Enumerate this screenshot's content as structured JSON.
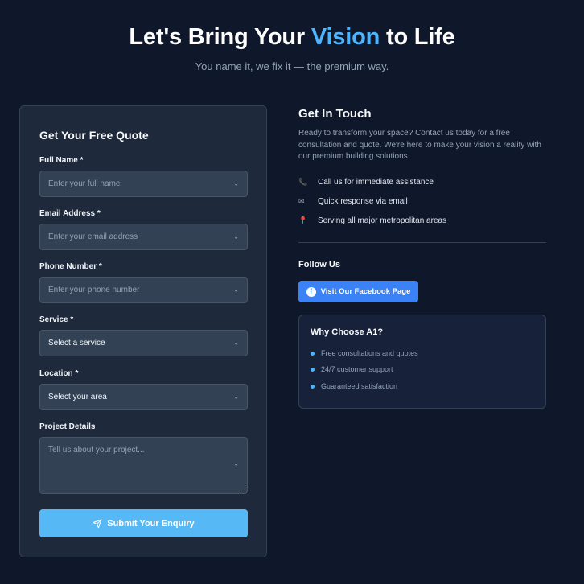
{
  "hero": {
    "title_before": "Let's Bring Your ",
    "title_accent": "Vision",
    "title_after": " to Life",
    "subtitle": "You name it, we fix it — the premium way."
  },
  "form": {
    "title": "Get Your Free Quote",
    "full_name": {
      "label": "Full Name *",
      "placeholder": "Enter your full name"
    },
    "email": {
      "label": "Email Address *",
      "placeholder": "Enter your email address"
    },
    "phone": {
      "label": "Phone Number *",
      "placeholder": "Enter your phone number"
    },
    "service": {
      "label": "Service *",
      "value": "Select a service"
    },
    "location": {
      "label": "Location *",
      "value": "Select your area"
    },
    "details": {
      "label": "Project Details",
      "placeholder": "Tell us about your project..."
    },
    "submit_label": "Submit Your Enquiry"
  },
  "contact": {
    "title": "Get In Touch",
    "description": "Ready to transform your space? Contact us today for a free consultation and quote. We're here to make your vision a reality with our premium building solutions.",
    "items": [
      {
        "icon": "phone-icon",
        "text": "Call us for immediate assistance"
      },
      {
        "icon": "email-icon",
        "text": "Quick response via email"
      },
      {
        "icon": "location-icon",
        "text": "Serving all major metropolitan areas"
      }
    ]
  },
  "follow": {
    "title": "Follow Us",
    "facebook_label": "Visit Our Facebook Page"
  },
  "why": {
    "title": "Why Choose A1?",
    "items": [
      "Free consultations and quotes",
      "24/7 customer support",
      "Guaranteed satisfaction"
    ]
  },
  "colors": {
    "background": "#0f172a",
    "accent": "#4db5ff",
    "submit": "#56b9f5",
    "facebook": "#3b82f6"
  }
}
